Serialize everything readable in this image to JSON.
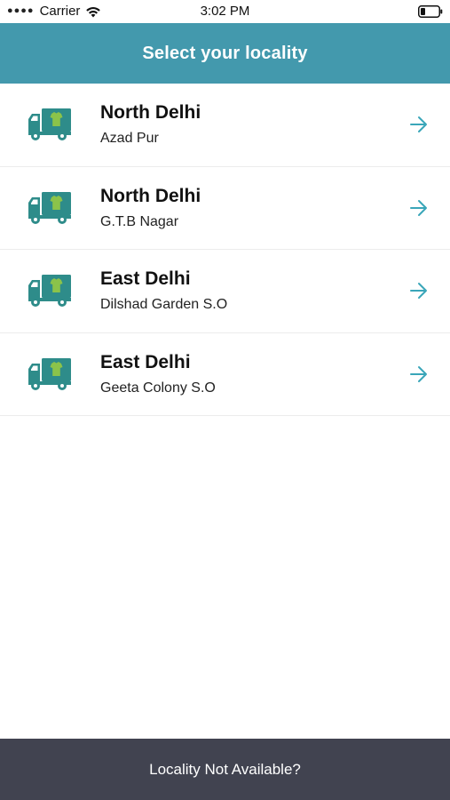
{
  "status_bar": {
    "carrier": "Carrier",
    "time": "3:02 PM",
    "signal_icon": "signal-dots-icon",
    "wifi_icon": "wifi-icon",
    "battery_icon": "battery-icon"
  },
  "header": {
    "title": "Select your locality",
    "background": "#4399ad"
  },
  "localities": [
    {
      "region": "North Delhi",
      "area": "Azad Pur"
    },
    {
      "region": "North Delhi",
      "area": "G.T.B Nagar"
    },
    {
      "region": "East Delhi",
      "area": "Dilshad Garden S.O"
    },
    {
      "region": "East Delhi",
      "area": "Geeta Colony S.O"
    }
  ],
  "icons": {
    "item_icon": "delivery-truck-icon",
    "arrow": "arrow-right-icon",
    "truck_color": "#2e8c8a",
    "shirt_color": "#8bc34a",
    "arrow_color": "#3aa6b9"
  },
  "footer": {
    "label": "Locality Not Available?",
    "background": "#414350"
  }
}
